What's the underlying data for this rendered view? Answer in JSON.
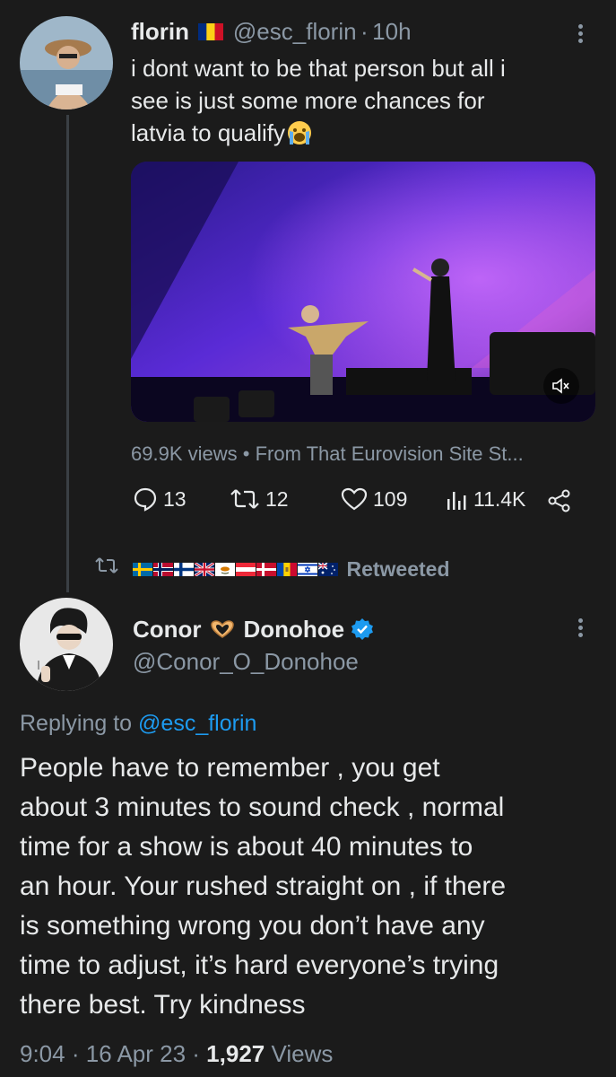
{
  "tweet1": {
    "name": "florin",
    "handle": "@esc_florin",
    "sep": "·",
    "time": "10h",
    "text_line1": "i dont want to be that person but all i",
    "text_line2": "see is just some more chances for",
    "text_line3": "latvia to qualify",
    "views": "69.9K views",
    "source": "From That Eurovision Site St...",
    "replies": "13",
    "retweets": "12",
    "likes": "109",
    "view_count": "11.4K"
  },
  "retweet_banner": {
    "label": "Retweeted"
  },
  "tweet2": {
    "name_first": "Conor",
    "name_last": "Donohoe",
    "handle": "@Conor_O_Donohoe",
    "replying_prefix": "Replying to",
    "replying_handle": "@esc_florin",
    "lines": [
      "People have to remember , you get",
      "about 3 minutes to sound check , normal",
      "time for a show is about 40 minutes to",
      "an hour. Your rushed straight on , if there",
      "is something wrong you don’t have any",
      "time to adjust, it’s hard everyone’s trying",
      "there best. Try kindness"
    ],
    "time": "9:04",
    "date": "16 Apr 23",
    "views_count": "1,927",
    "views_label": "Views"
  },
  "colors": {
    "background": "#1b1b1b",
    "link": "#1d9bf0",
    "muted": "#8b98a5",
    "verified": "#1d9bf0"
  }
}
